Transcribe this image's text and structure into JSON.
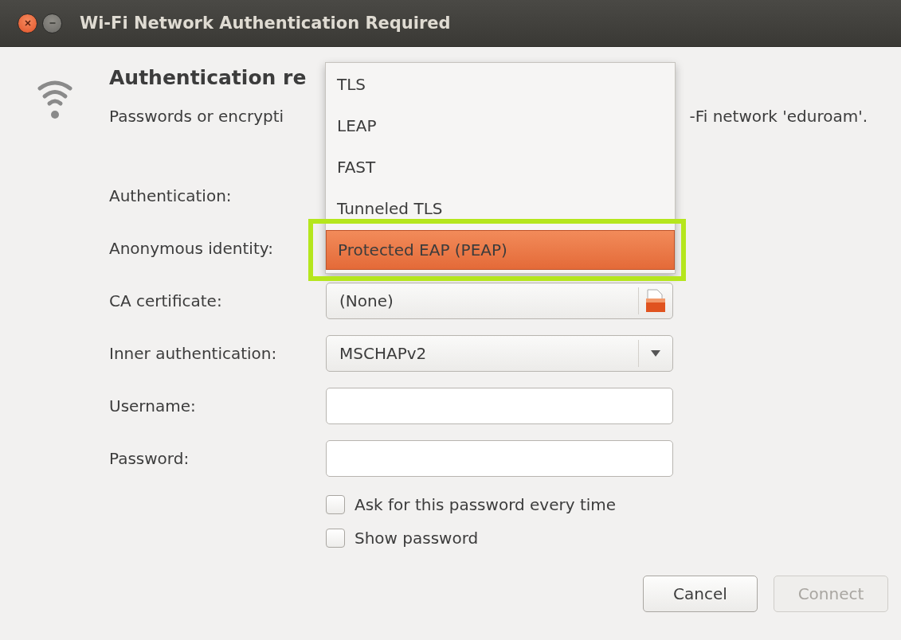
{
  "window": {
    "title": "Wi-Fi Network Authentication Required"
  },
  "heading": "Authentication re",
  "description": {
    "left": "Passwords or encrypti",
    "right": "-Fi network 'eduroam'."
  },
  "form": {
    "rows": [
      {
        "label": "Authentication:",
        "kind": "combo"
      },
      {
        "label": "Anonymous identity:",
        "kind": "entry"
      },
      {
        "label": "CA certificate:",
        "kind": "file",
        "value": "(None)"
      },
      {
        "label": "Inner authentication:",
        "kind": "combo",
        "value": "MSCHAPv2"
      },
      {
        "label": "Username:",
        "kind": "entry"
      },
      {
        "label": "Password:",
        "kind": "entry"
      }
    ]
  },
  "checkboxes": [
    {
      "label": "Ask for this password every time",
      "checked": false
    },
    {
      "label": "Show password",
      "checked": false
    }
  ],
  "buttons": [
    {
      "label": "Cancel",
      "disabled": false
    },
    {
      "label": "Connect",
      "disabled": true
    }
  ],
  "dropdown_menu": {
    "items": [
      {
        "label": "TLS",
        "selected": false,
        "annotated": false
      },
      {
        "label": "LEAP",
        "selected": false,
        "annotated": false
      },
      {
        "label": "FAST",
        "selected": false,
        "annotated": false
      },
      {
        "label": "Tunneled TLS",
        "selected": false,
        "annotated": false
      },
      {
        "label": "Protected EAP (PEAP)",
        "selected": true,
        "annotated": true
      }
    ]
  }
}
